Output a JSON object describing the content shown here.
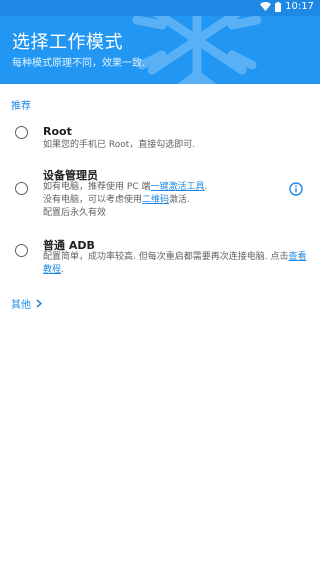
{
  "status_bar": {
    "time": "10:17"
  },
  "header": {
    "title": "选择工作模式",
    "subtitle": "每种模式原理不同，效果一致."
  },
  "section": {
    "recommended_label": "推荐"
  },
  "options": [
    {
      "title": "Root",
      "desc_line1": "如果您的手机已 Root，直接勾选即可."
    },
    {
      "title": "设备管理员",
      "line1_prefix": "如有电脑，推荐使用 PC 端",
      "line1_link": "一键激活工具",
      "line1_suffix": ".",
      "line2_prefix": "没有电脑，可以考虑使用",
      "line2_link": "二维码",
      "line2_suffix": "激活.",
      "line3": "配置后永久有效"
    },
    {
      "title": "普通 ADB",
      "line1_prefix": "配置简单，成功率较高. 但每次重启都需要再次连接电脑. 点击",
      "line1_link": "查看教程",
      "line1_suffix": "."
    }
  ],
  "more": {
    "label": "其他"
  },
  "colors": {
    "primary": "#2196f3",
    "primary_dark": "#1e88e5",
    "accent_link": "#1e88e5"
  },
  "icons": {
    "info": "info-icon",
    "chevron": "chevron-right-icon",
    "wifi": "wifi-icon",
    "battery": "battery-icon"
  }
}
